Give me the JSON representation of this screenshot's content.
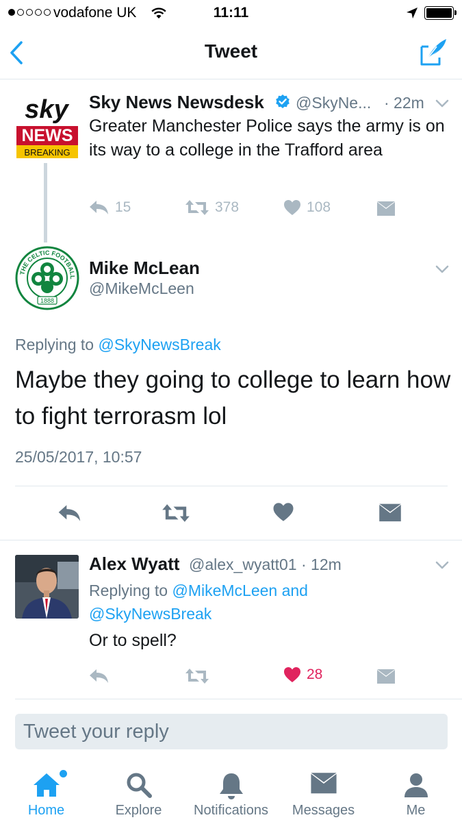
{
  "status_bar": {
    "carrier": "vodafone UK",
    "time": "11:11",
    "signal_bars": 1,
    "signal_total": 5,
    "battery": "full"
  },
  "nav": {
    "title": "Tweet",
    "back_icon": "chevron-left-icon",
    "compose_icon": "compose-tweet-icon"
  },
  "parent_tweet": {
    "name": "Sky News Newsdesk",
    "verified": true,
    "handle": "@SkyNe...",
    "time": "· 22m",
    "text": "Greater Manchester Police says the army is on its way to a college in the Trafford area",
    "avatar": {
      "logo_text_1": "sky",
      "logo_text_2": "NEWS",
      "logo_text_3": "BREAKING"
    },
    "replies": "15",
    "retweets": "378",
    "likes": "108"
  },
  "main_tweet": {
    "name": "Mike McLean",
    "handle": "@MikeMcLeen",
    "replying_prefix": "Replying to ",
    "replying_to": "@SkyNewsBreak",
    "text": "Maybe they going to college to learn how to fight terrorasm lol",
    "timestamp": "25/05/2017, 10:57",
    "avatar": {
      "ring_text": "THE CELTIC FOOTBALL CLUB",
      "year": "1888"
    }
  },
  "reply_tweet": {
    "name": "Alex Wyatt",
    "handle": "@alex_wyatt01",
    "time": "· 12m",
    "replying_prefix": "Replying to ",
    "replying_to_1": "@MikeMcLeen",
    "replying_and": " and",
    "replying_to_2": "@SkyNewsBreak",
    "text": "Or to spell?",
    "likes": "28",
    "liked": true
  },
  "reply_box": {
    "placeholder": "Tweet your reply"
  },
  "tab_bar": {
    "tabs": [
      {
        "label": "Home",
        "icon": "home-icon",
        "active": true
      },
      {
        "label": "Explore",
        "icon": "search-icon",
        "active": false
      },
      {
        "label": "Notifications",
        "icon": "bell-icon",
        "active": false
      },
      {
        "label": "Messages",
        "icon": "envelope-icon",
        "active": false
      },
      {
        "label": "Me",
        "icon": "person-icon",
        "active": false
      }
    ]
  },
  "colors": {
    "accent": "#1da1f2",
    "text": "#14171a",
    "muted": "#657786",
    "action_gray": "#aab8c2",
    "like_red": "#e0245e",
    "sky_red": "#c8102e",
    "celtic_green": "#11853f"
  }
}
